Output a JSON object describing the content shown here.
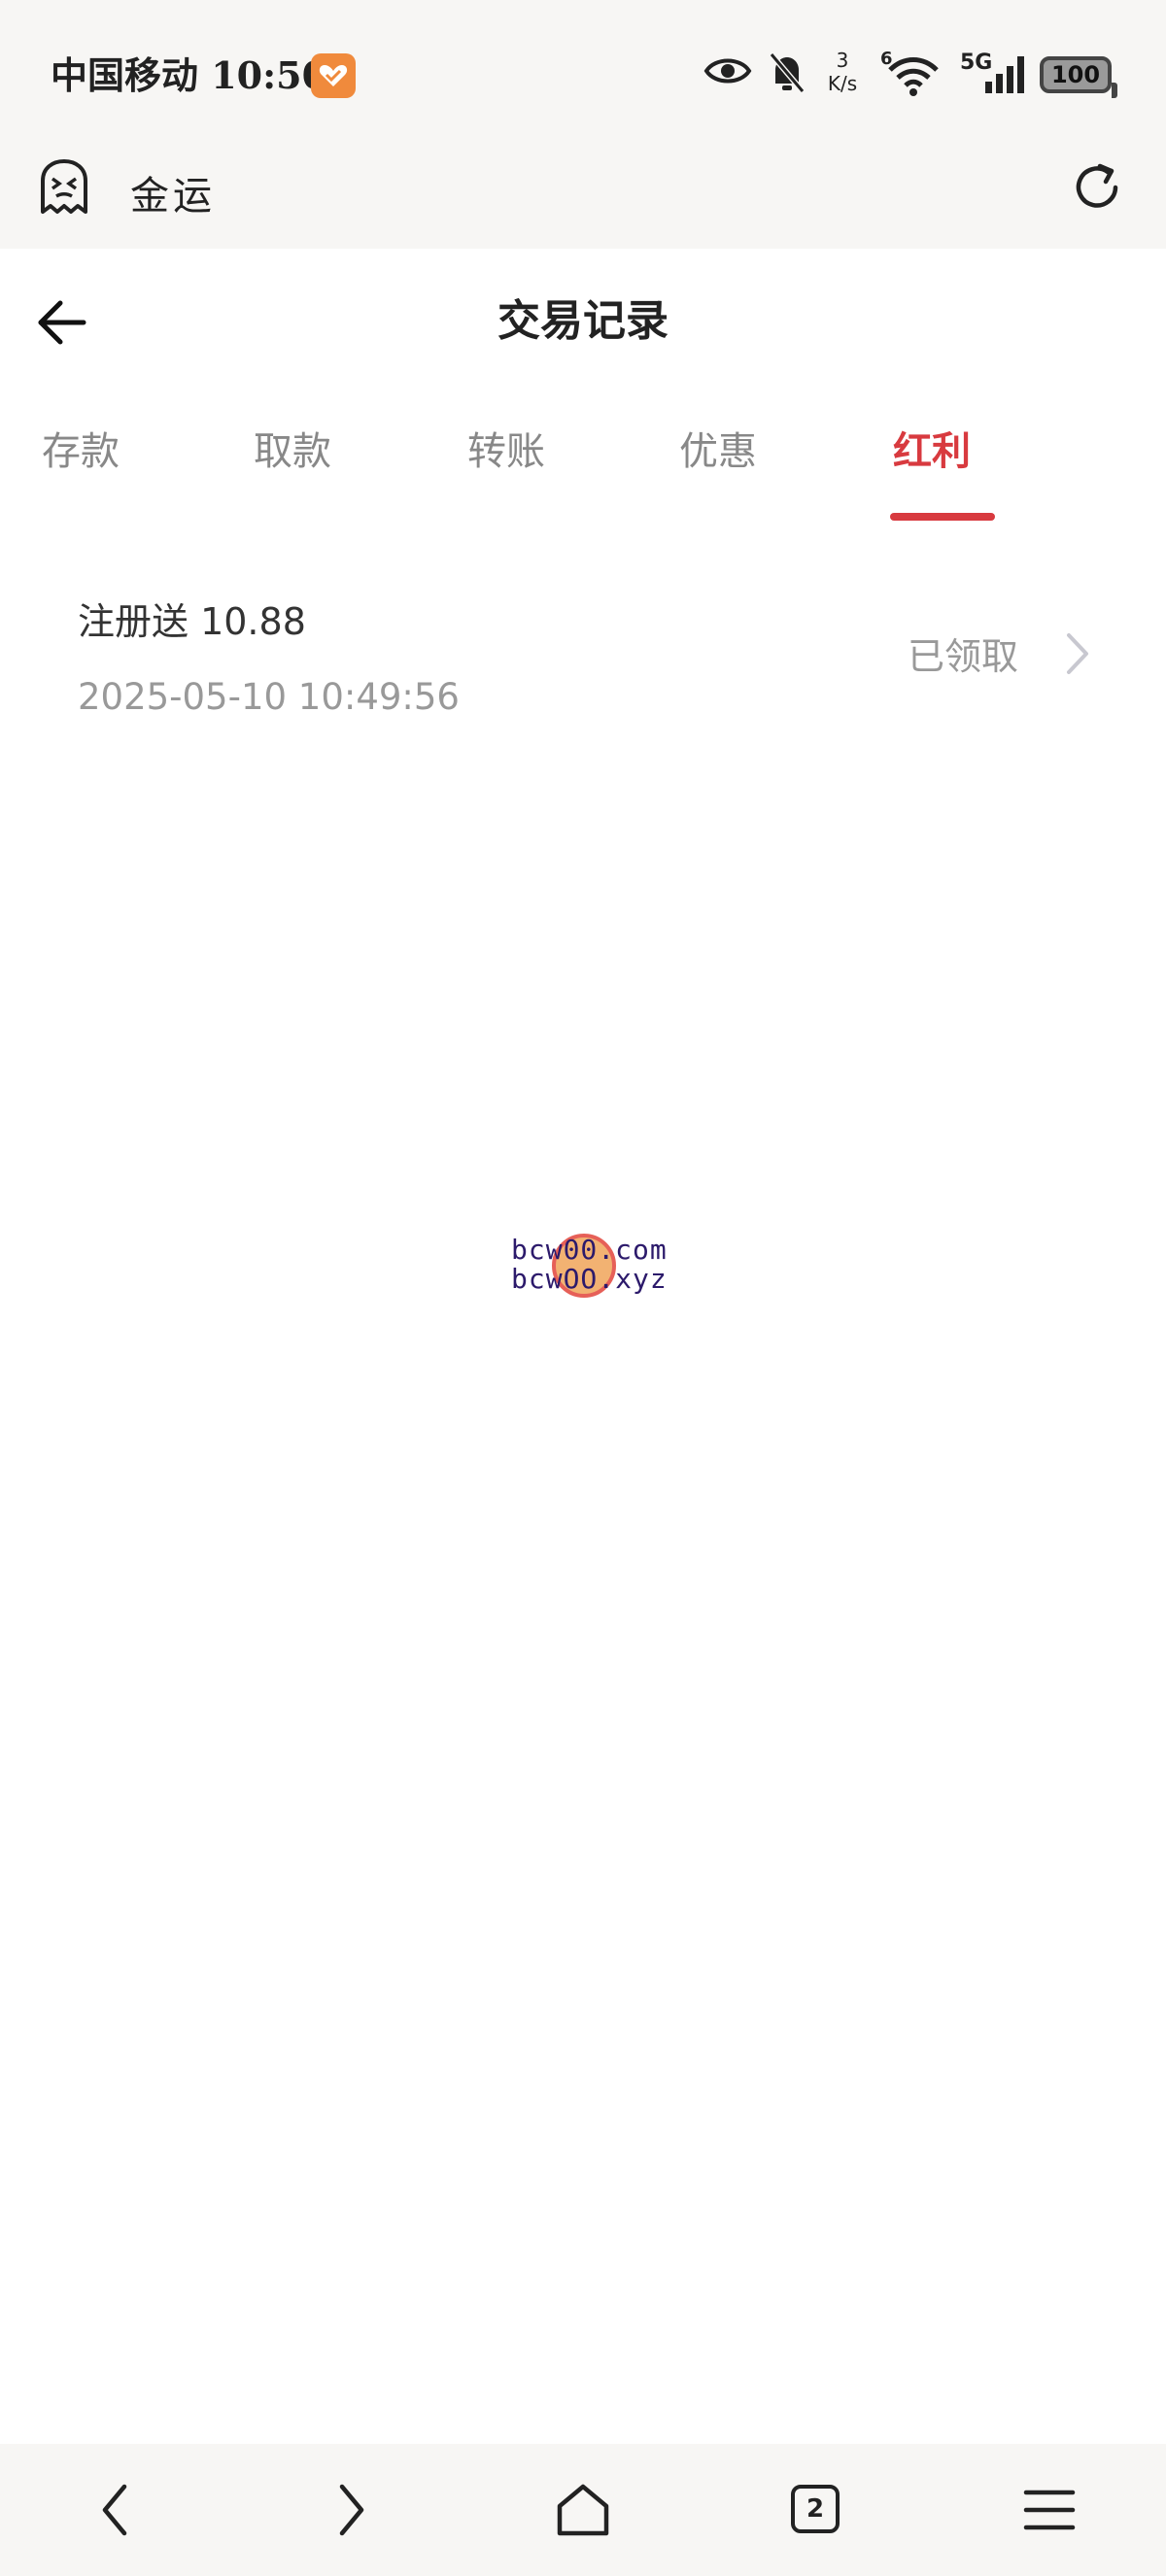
{
  "status_bar": {
    "carrier_time": "中国移动 10:50",
    "network_speed_value": "3",
    "network_speed_unit": "K/s",
    "network_type": "5G",
    "wifi_label": "6",
    "battery": "100"
  },
  "app_header": {
    "title": "金运"
  },
  "page": {
    "title": "交易记录"
  },
  "tabs": [
    {
      "label": "存款",
      "active": false
    },
    {
      "label": "取款",
      "active": false
    },
    {
      "label": "转账",
      "active": false
    },
    {
      "label": "优惠",
      "active": false
    },
    {
      "label": "红利",
      "active": true
    }
  ],
  "records": [
    {
      "title": "注册送 10.88",
      "time": "2025-05-10 10:49:56",
      "status": "已领取"
    }
  ],
  "watermark": {
    "line1": "bcw00.com",
    "line2": "bcwOO.xyz"
  },
  "bottom_bar": {
    "tab_count": "2"
  },
  "colors": {
    "accent": "#d83a3f",
    "bar_background": "#f7f6f4",
    "muted_text": "#999999"
  }
}
